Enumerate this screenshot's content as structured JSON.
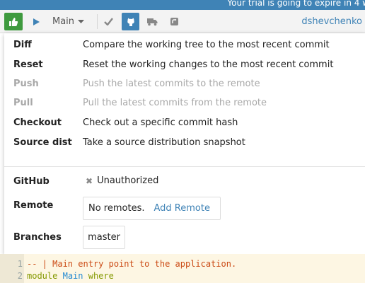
{
  "trial_banner": "Your trial is going to expire in 4 w",
  "toolbar": {
    "branch": "Main",
    "user": "dshevchenko"
  },
  "commands": [
    {
      "name": "Diff",
      "desc": "Compare the working tree to the most recent commit",
      "enabled": true
    },
    {
      "name": "Reset",
      "desc": "Reset the working changes to the most recent commit",
      "enabled": true
    },
    {
      "name": "Push",
      "desc": "Push the latest commits to the remote",
      "enabled": false
    },
    {
      "name": "Pull",
      "desc": "Pull the latest commits from the remote",
      "enabled": false
    },
    {
      "name": "Checkout",
      "desc": "Check out a specific commit hash",
      "enabled": true
    },
    {
      "name": "Source dist",
      "desc": "Take a source distribution snapshot",
      "enabled": true
    }
  ],
  "github": {
    "label": "GitHub",
    "status": "Unauthorized"
  },
  "remote": {
    "label": "Remote",
    "value": "No remotes.",
    "add_link": "Add Remote"
  },
  "branches": {
    "label": "Branches",
    "items": [
      "master"
    ]
  },
  "editor": {
    "lines": [
      {
        "num": "1",
        "comment": "-- | Main entry point to the application."
      },
      {
        "num": "2",
        "keyword": "module",
        "type": "Main",
        "keyword2": "where"
      }
    ]
  },
  "colors": {
    "accent": "#3f83b6",
    "green": "#3e9a3e",
    "disabled": "#a8a8a8"
  },
  "icons": [
    "thumbs-up-icon",
    "play-icon",
    "chevron-down-icon",
    "check-icon",
    "github-icon",
    "truck-icon",
    "fork-icon",
    "close-icon"
  ]
}
